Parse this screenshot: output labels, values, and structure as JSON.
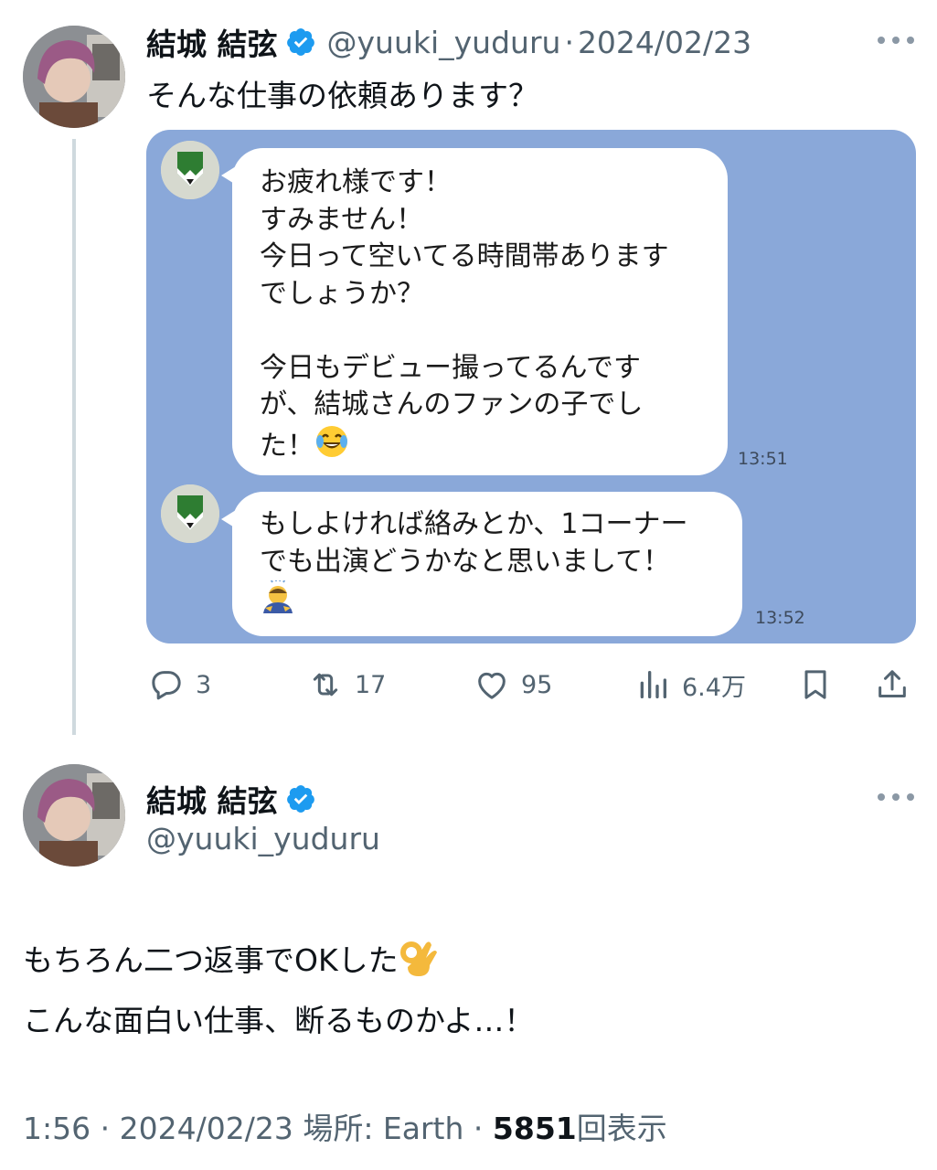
{
  "colors": {
    "verified": "#1d9bf0",
    "secondary_text": "#536471",
    "media_background": "#8aa8d9",
    "line_icon_green": "#2e7d32"
  },
  "tweet1": {
    "name": "結城 結弦",
    "verified_icon": "verified-badge-icon",
    "handle": "@yuuki_yuduru",
    "separator": "·",
    "date": "2024/02/23",
    "text": "そんな仕事の依頼あります？",
    "chat": {
      "message1": {
        "lines": [
          "お疲れ様です！",
          "すみません！",
          "今日って空いてる時間帯あります",
          "でしょうか？",
          "",
          "今日もデビュー撮ってるんです",
          "が、結城さんのファンの子でし",
          "た！"
        ],
        "emoji": "laughing-tears-emoji",
        "time": "13:51"
      },
      "message2": {
        "lines": [
          "もしよければ絡みとか、1コーナー",
          "でも出演どうかなと思いまして！"
        ],
        "emoji": "bowing-person-emoji",
        "time": "13:52"
      }
    },
    "actions": {
      "reply_count": "3",
      "retweet_count": "17",
      "like_count": "95",
      "view_count": "6.4万"
    }
  },
  "tweet2": {
    "name": "結城 結弦",
    "handle": "@yuuki_yuduru",
    "text_line1": "もちろん二つ返事でOKした",
    "text_line2": "こんな面白い仕事、断るものかよ…！",
    "emoji": "ok-hand-emoji",
    "footer": {
      "time": "1:56",
      "sep1": "·",
      "date": "2024/02/23",
      "location_label": "場所: Earth",
      "sep2": "·",
      "views_number": "5851",
      "views_label": "回表示"
    }
  }
}
